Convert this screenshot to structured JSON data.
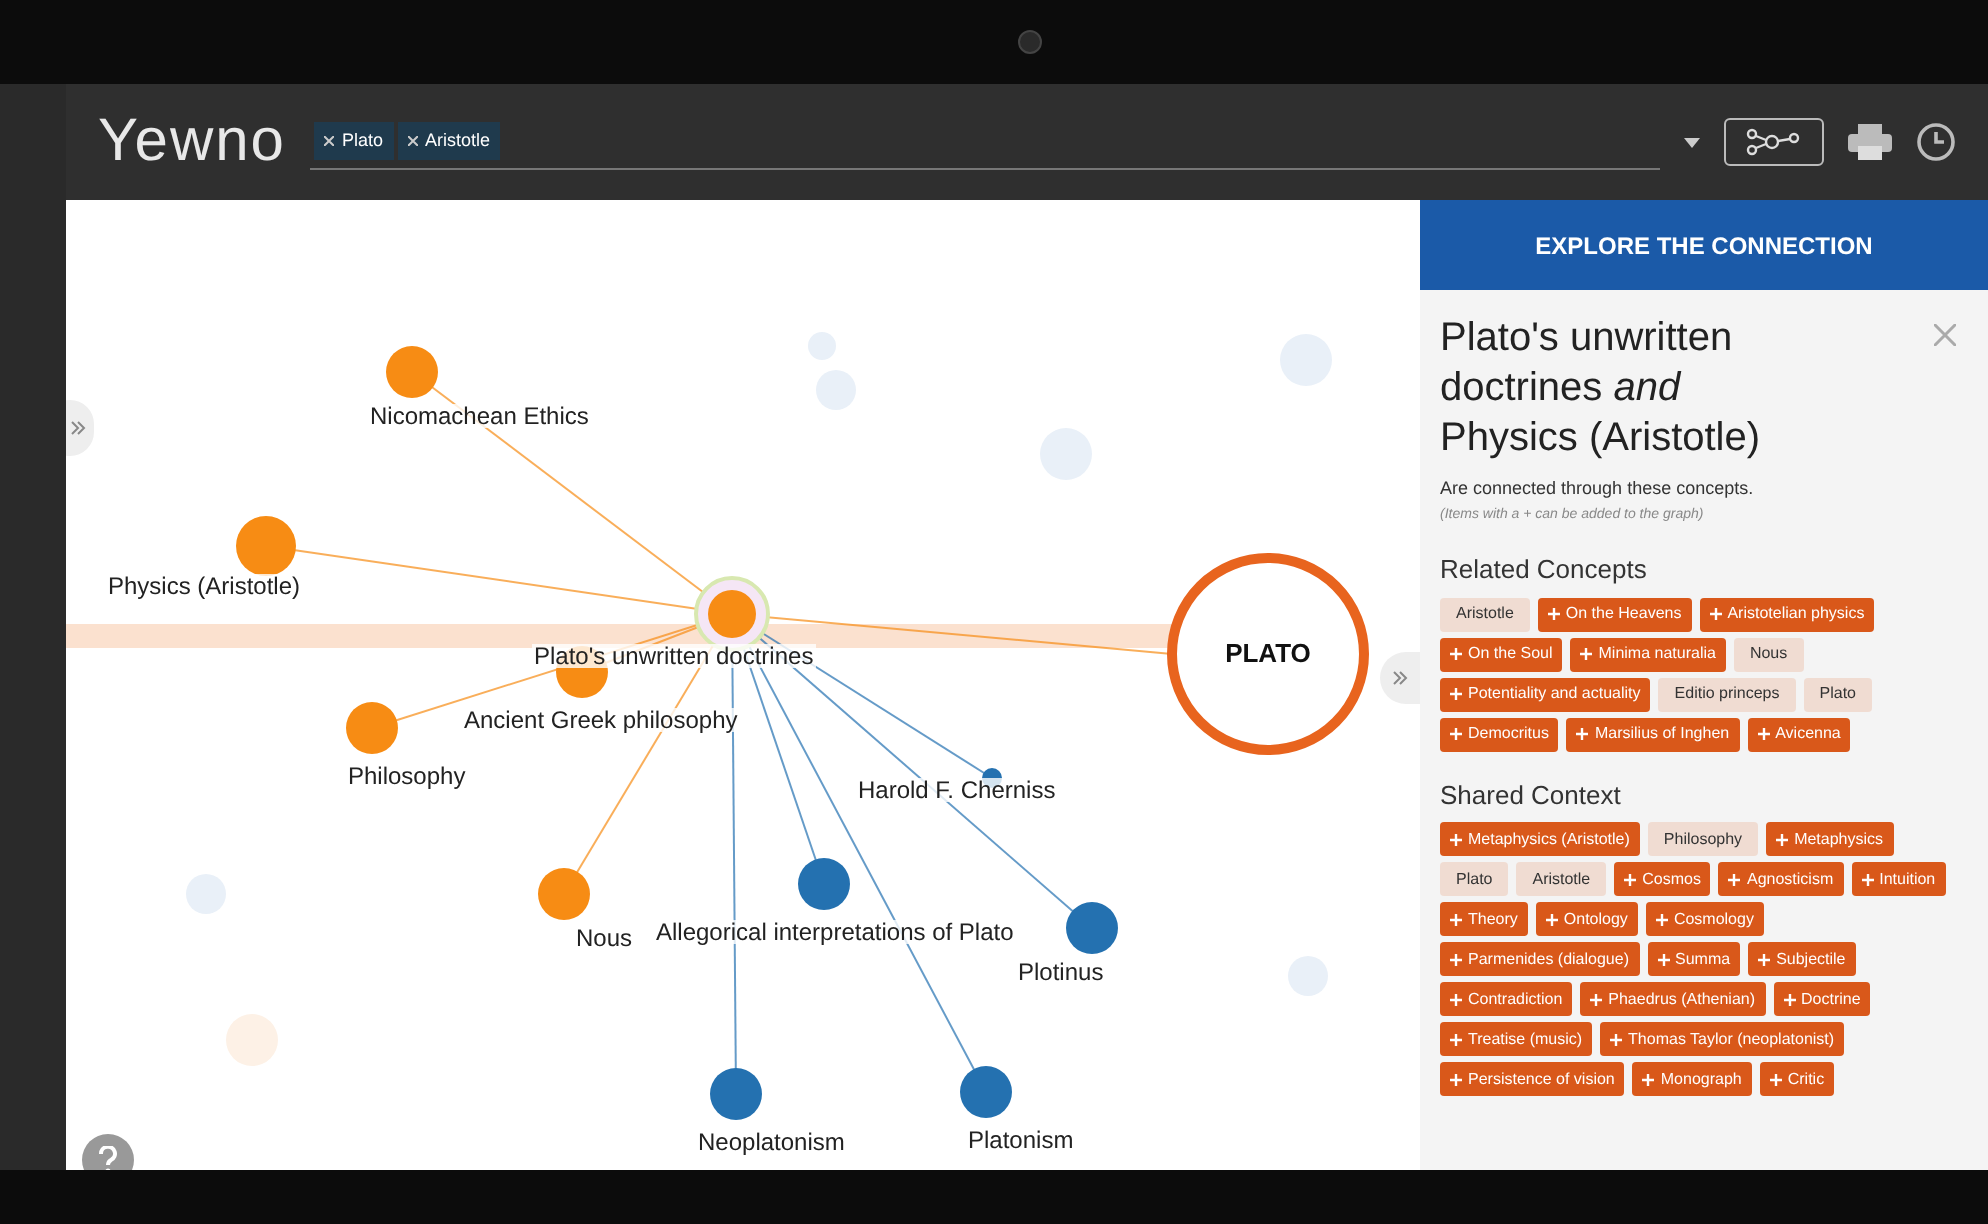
{
  "app": {
    "logo": "Yewno"
  },
  "search": {
    "tags": [
      {
        "label": "Plato"
      },
      {
        "label": "Aristotle"
      }
    ]
  },
  "graph": {
    "nodes": [
      {
        "label": "Nicomachean Ethics",
        "color": "#f78c14"
      },
      {
        "label": "Physics (Aristotle)",
        "color": "#f78c14"
      },
      {
        "label": "Plato's unwritten doctrines",
        "color": "#f78c14",
        "selected": true
      },
      {
        "label": "Ancient Greek philosophy",
        "color": "#f78c14"
      },
      {
        "label": "Philosophy",
        "color": "#f78c14"
      },
      {
        "label": "Harold F. Cherniss",
        "color": "#2471b0"
      },
      {
        "label": "Nous",
        "color": "#f78c14"
      },
      {
        "label": "Allegorical interpretations of Plato",
        "color": "#2471b0"
      },
      {
        "label": "Plotinus",
        "color": "#2471b0"
      },
      {
        "label": "Neoplatonism",
        "color": "#2471b0"
      },
      {
        "label": "Platonism",
        "color": "#2471b0"
      }
    ],
    "focus_node": {
      "label": "PLATO"
    }
  },
  "panel": {
    "header": "EXPLORE THE CONNECTION",
    "title": "Plato's unwritten doctrines *and* Physics (Aristotle)",
    "subtitle": "Are connected through these concepts.",
    "hint": "(Items with a + can be added to the graph)",
    "sections": [
      {
        "heading": "Related Concepts",
        "tags": [
          {
            "label": "Aristotle",
            "kind": "plain"
          },
          {
            "label": "On the Heavens",
            "kind": "addable"
          },
          {
            "label": "Aristotelian physics",
            "kind": "addable"
          },
          {
            "label": "On the Soul",
            "kind": "addable"
          },
          {
            "label": "Minima naturalia",
            "kind": "addable"
          },
          {
            "label": "Nous",
            "kind": "plain"
          },
          {
            "label": "Potentiality and actuality",
            "kind": "addable"
          },
          {
            "label": "Editio princeps",
            "kind": "plain"
          },
          {
            "label": "Plato",
            "kind": "plain"
          },
          {
            "label": "Democritus",
            "kind": "addable"
          },
          {
            "label": "Marsilius of Inghen",
            "kind": "addable"
          },
          {
            "label": "Avicenna",
            "kind": "addable"
          }
        ]
      },
      {
        "heading": "Shared Context",
        "tags": [
          {
            "label": "Metaphysics (Aristotle)",
            "kind": "addable"
          },
          {
            "label": "Philosophy",
            "kind": "plain"
          },
          {
            "label": "Metaphysics",
            "kind": "addable"
          },
          {
            "label": "Plato",
            "kind": "plain"
          },
          {
            "label": "Aristotle",
            "kind": "plain"
          },
          {
            "label": "Cosmos",
            "kind": "addable"
          },
          {
            "label": "Agnosticism",
            "kind": "addable"
          },
          {
            "label": "Intuition",
            "kind": "addable"
          },
          {
            "label": "Theory",
            "kind": "addable"
          },
          {
            "label": "Ontology",
            "kind": "addable"
          },
          {
            "label": "Cosmology",
            "kind": "addable"
          },
          {
            "label": "Parmenides (dialogue)",
            "kind": "addable"
          },
          {
            "label": "Summa",
            "kind": "addable"
          },
          {
            "label": "Subjectile",
            "kind": "addable"
          },
          {
            "label": "Contradiction",
            "kind": "addable"
          },
          {
            "label": "Phaedrus (Athenian)",
            "kind": "addable"
          },
          {
            "label": "Doctrine",
            "kind": "addable"
          },
          {
            "label": "Treatise (music)",
            "kind": "addable"
          },
          {
            "label": "Thomas Taylor (neoplatonist)",
            "kind": "addable"
          },
          {
            "label": "Persistence of vision",
            "kind": "addable"
          },
          {
            "label": "Monograph",
            "kind": "addable"
          },
          {
            "label": "Critic",
            "kind": "addable"
          }
        ]
      }
    ]
  }
}
